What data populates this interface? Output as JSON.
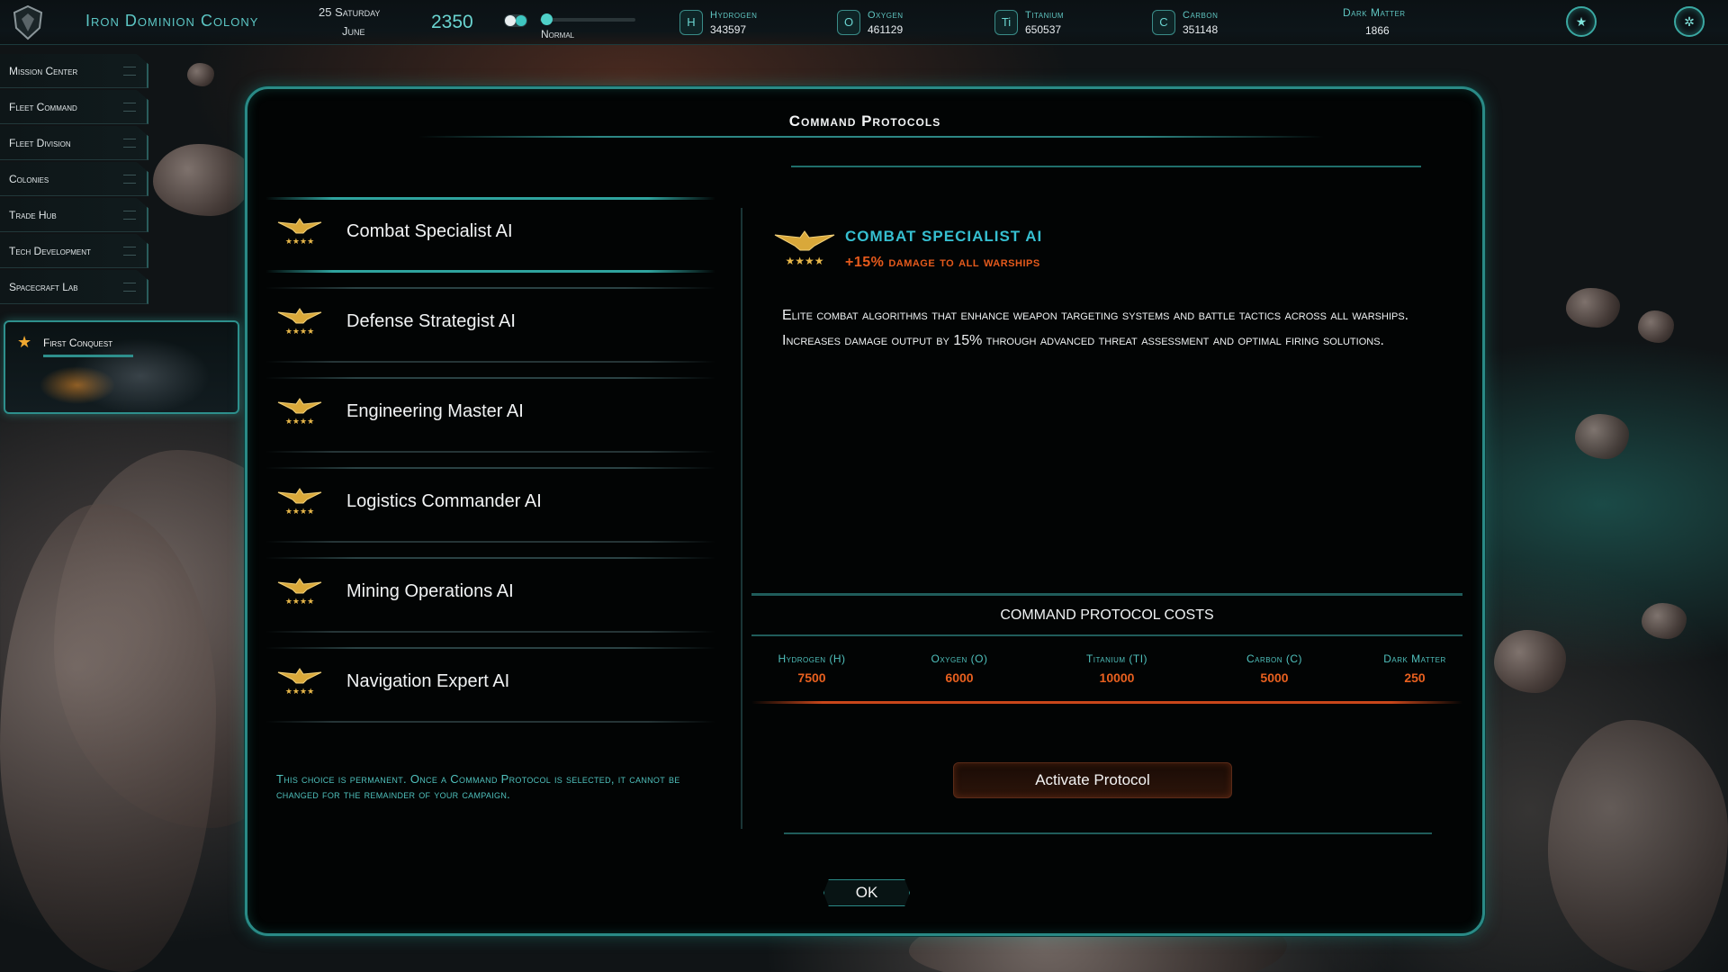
{
  "topbar": {
    "colony_name": "Iron Dominion Colony",
    "date_line1": "25 Saturday",
    "date_line2": "June",
    "year": "2350",
    "speed_label": "Normal",
    "resources": [
      {
        "code": "H",
        "name": "Hydrogen",
        "value": "343597"
      },
      {
        "code": "O",
        "name": "Oxygen",
        "value": "461129"
      },
      {
        "code": "Ti",
        "name": "Titanium",
        "value": "650537"
      },
      {
        "code": "C",
        "name": "Carbon",
        "value": "351148"
      }
    ],
    "dark_matter": {
      "name": "Dark Matter",
      "value": "1866"
    }
  },
  "nav": {
    "items": [
      {
        "label": "Mission Center"
      },
      {
        "label": "Fleet Command"
      },
      {
        "label": "Fleet Division"
      },
      {
        "label": "Colonies"
      },
      {
        "label": "Trade Hub"
      },
      {
        "label": "Tech Development"
      },
      {
        "label": "Spacecraft Lab"
      }
    ],
    "quest_title": "First Conquest"
  },
  "dialog": {
    "title": "Command Protocols",
    "protocols": [
      {
        "label": "Combat Specialist AI",
        "selected": true
      },
      {
        "label": "Defense Strategist AI",
        "selected": false
      },
      {
        "label": "Engineering Master AI",
        "selected": false
      },
      {
        "label": "Logistics Commander AI",
        "selected": false
      },
      {
        "label": "Mining Operations AI",
        "selected": false
      },
      {
        "label": "Navigation Expert AI",
        "selected": false
      }
    ],
    "warning": "This choice is permanent. Once a Command Protocol is selected, it cannot be changed for the remainder of your campaign.",
    "detail": {
      "name": "COMBAT SPECIALIST AI",
      "bonus": "+15% damage to all warships",
      "description": "Elite combat algorithms that enhance weapon targeting systems and battle tactics across all warships. Increases damage output by 15% through advanced threat assessment and optimal firing solutions."
    },
    "costs": {
      "heading": "COMMAND PROTOCOL COSTS",
      "items": [
        {
          "name": "Hydrogen (H)",
          "value": "7500"
        },
        {
          "name": "Oxygen (O)",
          "value": "6000"
        },
        {
          "name": "Titanium (TI)",
          "value": "10000"
        },
        {
          "name": "Carbon (C)",
          "value": "5000"
        },
        {
          "name": "Dark Matter",
          "value": "250"
        }
      ]
    },
    "activate_label": "Activate Protocol",
    "ok_label": "OK"
  },
  "colors": {
    "accent": "#2a8a86",
    "teal_text": "#4fc0bc",
    "cost_orange": "#e8601f",
    "title_cyan": "#36bfd0"
  },
  "icons": [
    "emblem-icon",
    "eagle-badge-icon",
    "star-icon",
    "galaxy-button-icon",
    "settings-button-icon"
  ]
}
